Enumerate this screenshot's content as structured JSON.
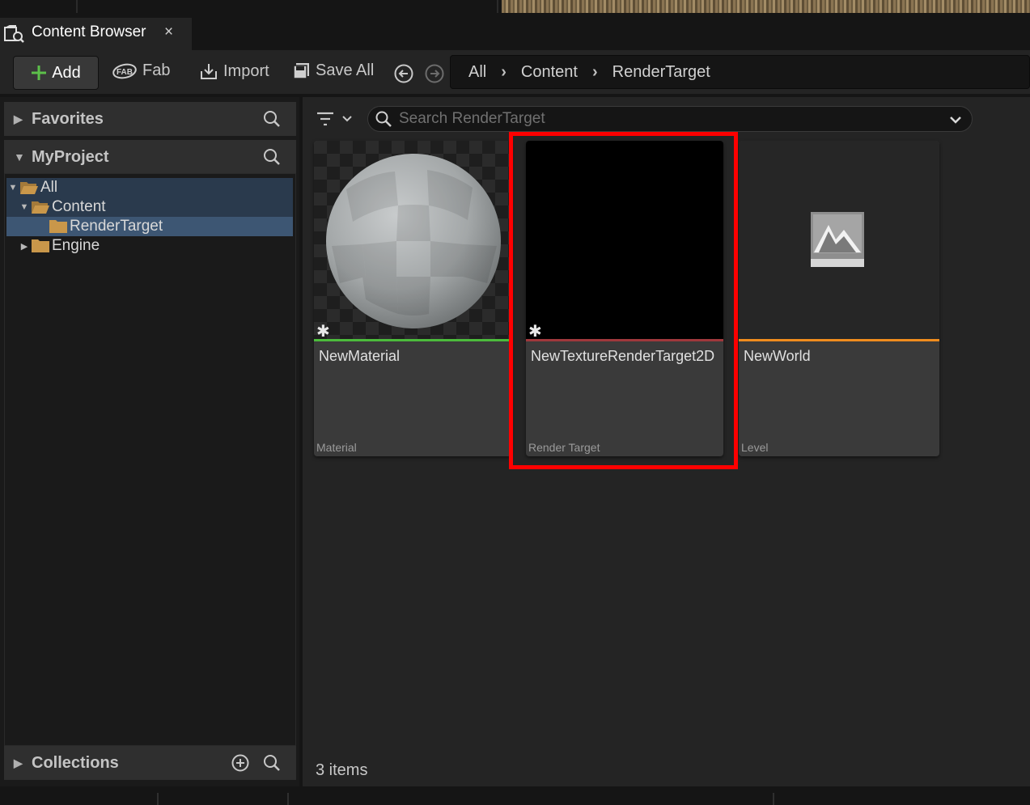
{
  "tab": {
    "title": "Content Browser",
    "close": "×",
    "icon": "content-browser-icon"
  },
  "toolbar": {
    "add_label": "Add",
    "fab_label": "Fab",
    "import_label": "Import",
    "save_all_label": "Save All"
  },
  "breadcrumb": {
    "items": [
      "All",
      "Content",
      "RenderTarget"
    ]
  },
  "sources": {
    "favorites_label": "Favorites",
    "myproject_label": "MyProject",
    "collections_label": "Collections",
    "tree": [
      {
        "label": "All",
        "depth": 0,
        "expanded": true
      },
      {
        "label": "Content",
        "depth": 1,
        "expanded": true
      },
      {
        "label": "RenderTarget",
        "depth": 2,
        "selected": true
      },
      {
        "label": "Engine",
        "depth": 1,
        "expanded": false
      }
    ]
  },
  "search": {
    "placeholder": "Search RenderTarget"
  },
  "assets": [
    {
      "name": "NewMaterial",
      "type": "Material",
      "color": "#4cbb3c"
    },
    {
      "name": "NewTextureRenderTarget2D",
      "type": "Render Target",
      "color": "#a0383c"
    },
    {
      "name": "NewWorld",
      "type": "Level",
      "color": "#f08c1e"
    }
  ],
  "status": {
    "item_count": "3 items"
  },
  "colors": {
    "highlight": "#ff0000",
    "selection": "#3d5673",
    "folder": "#c9974a"
  }
}
